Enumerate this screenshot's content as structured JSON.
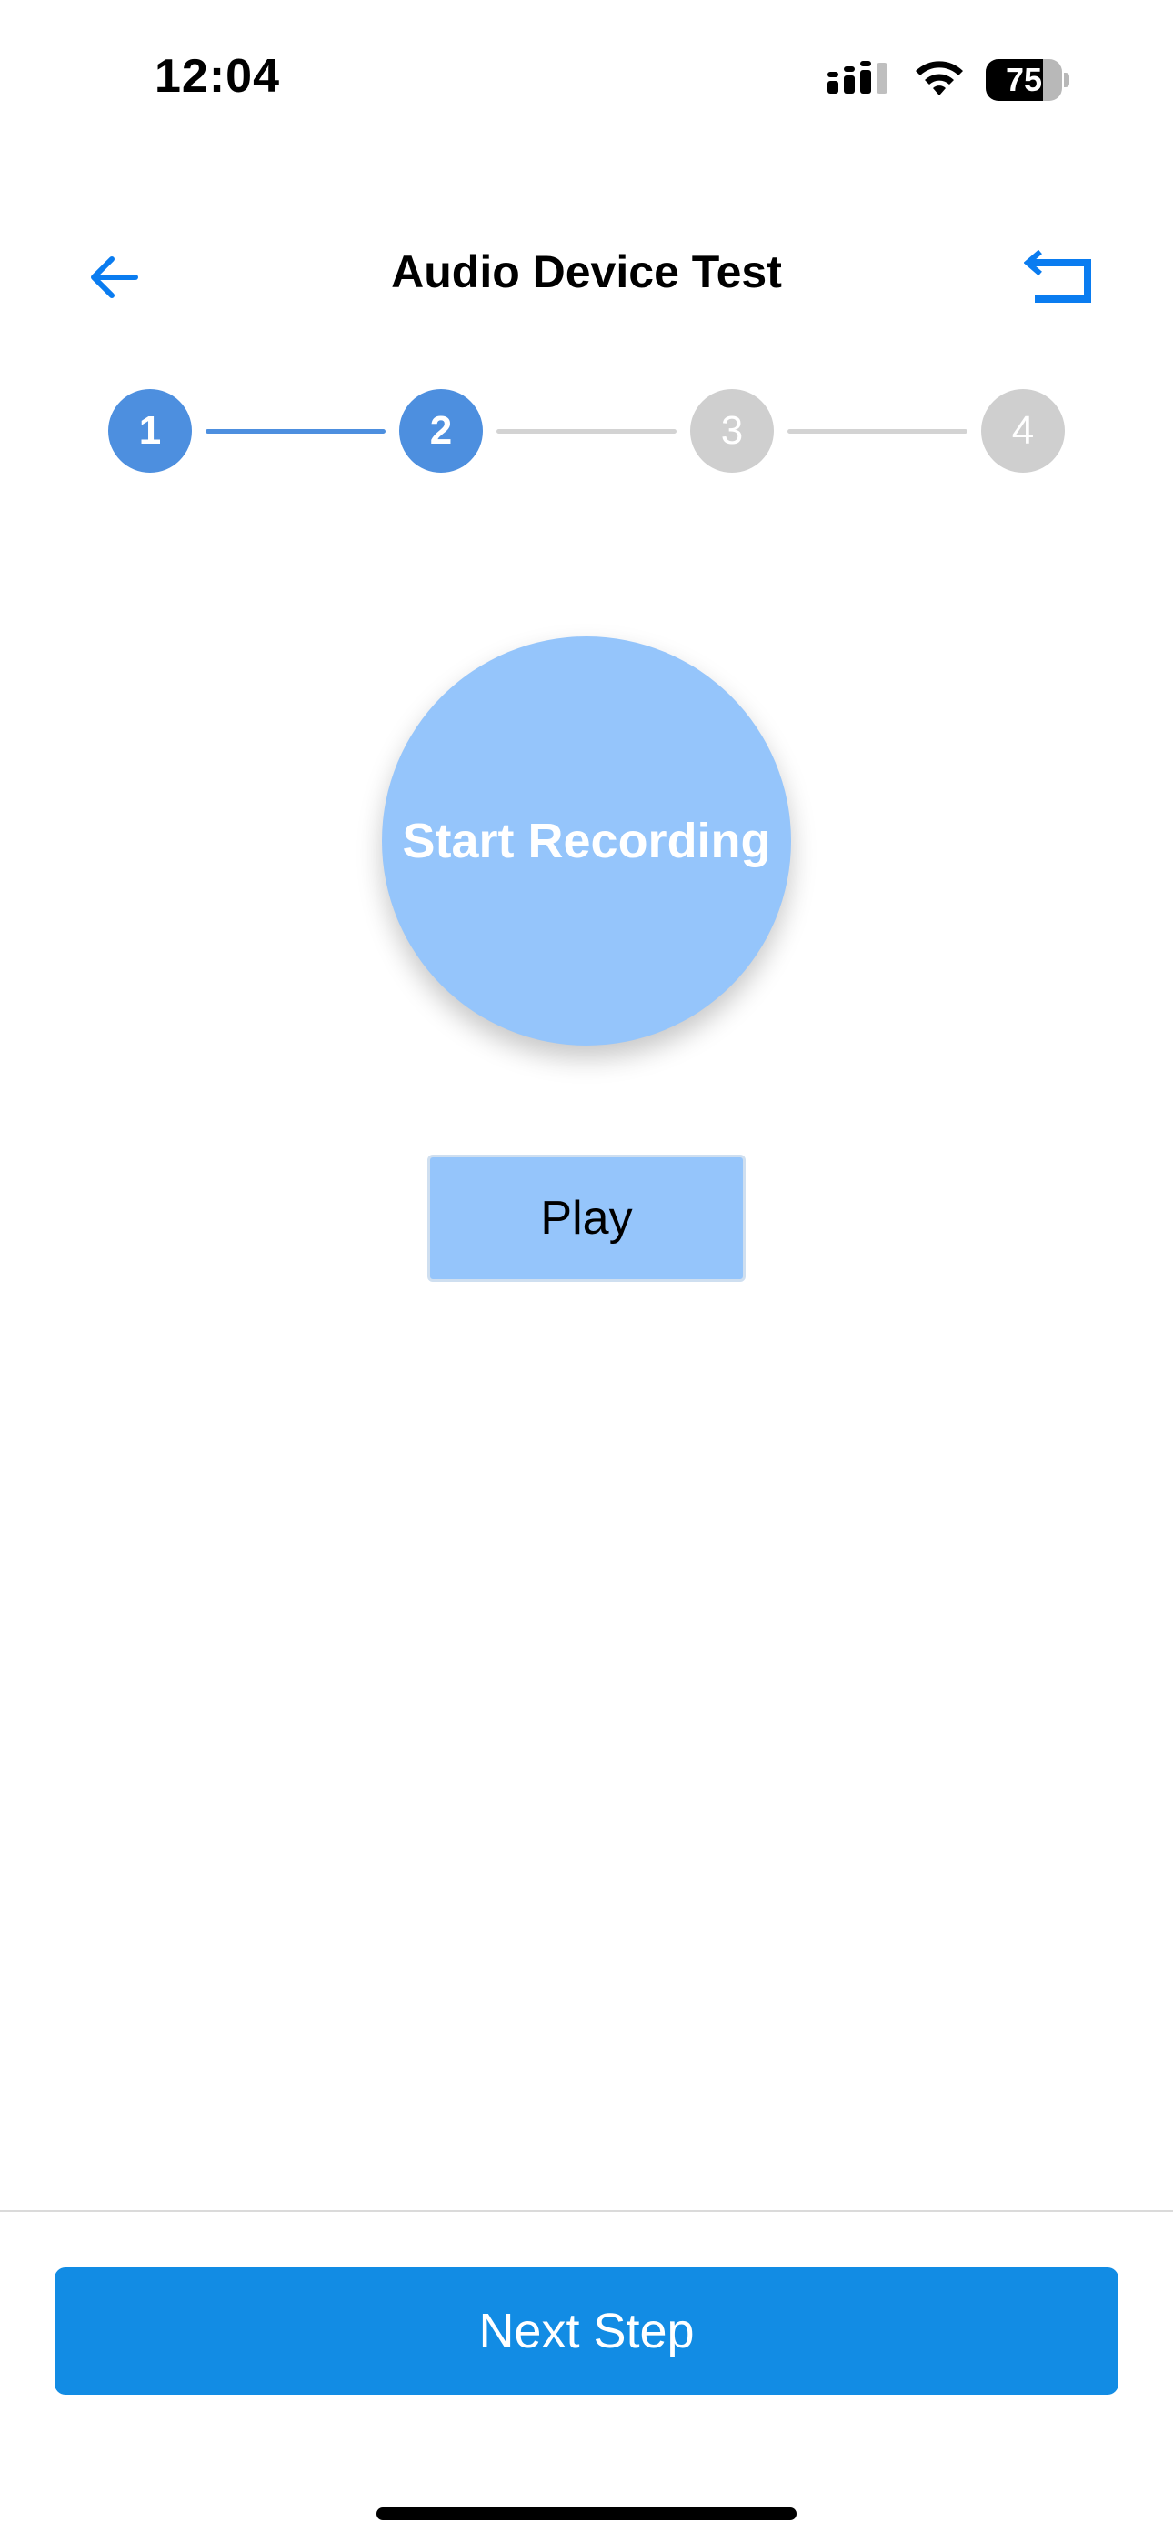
{
  "status_bar": {
    "time": "12:04",
    "battery_level": "75",
    "battery_fraction": 0.75,
    "icons": [
      "cellular-signal-icon",
      "wifi-icon",
      "battery-icon"
    ]
  },
  "nav": {
    "title": "Audio Device Test",
    "back_icon": "arrow-left-icon",
    "reset_icon": "return-arrow-icon",
    "accent_color": "#0a7cf0"
  },
  "stepper": {
    "steps": [
      {
        "label": "1",
        "state": "active"
      },
      {
        "label": "2",
        "state": "active"
      },
      {
        "label": "3",
        "state": "inactive"
      },
      {
        "label": "4",
        "state": "inactive"
      }
    ],
    "connectors": [
      "done",
      "todo",
      "todo"
    ],
    "active_color": "#4d8fdf",
    "inactive_color": "#cfcfcf"
  },
  "main": {
    "record_label": "Start Recording",
    "play_label": "Play",
    "button_color": "#95c5fb"
  },
  "footer": {
    "next_label": "Next Step",
    "next_color": "#128ce4"
  }
}
